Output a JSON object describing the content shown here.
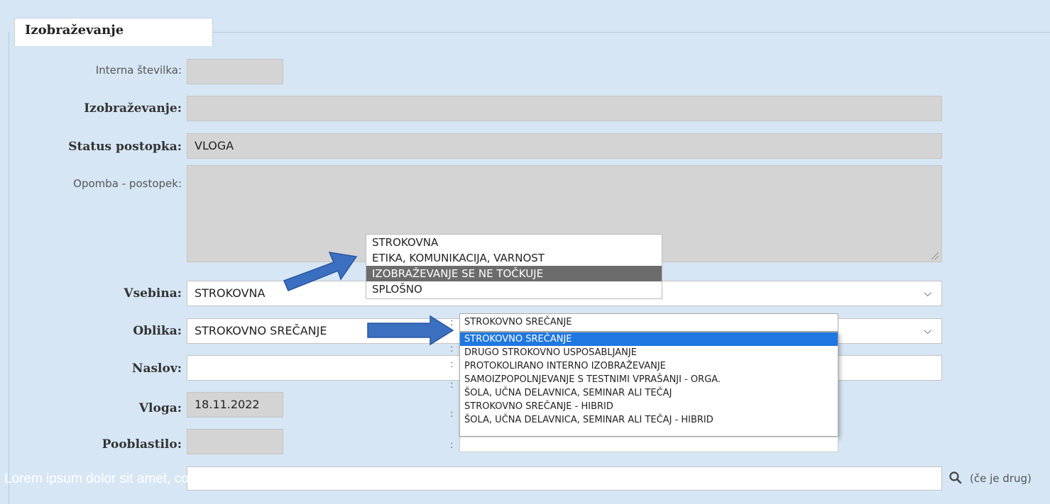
{
  "section": {
    "legend": "Izobraževanje"
  },
  "form": {
    "interna_stevilka": {
      "label": "Interna številka:",
      "value": ""
    },
    "izobrazevanje": {
      "label": "Izobraževanje:",
      "value": ""
    },
    "status": {
      "label": "Status postopka:",
      "value": "VLOGA"
    },
    "opomba": {
      "label": "Opomba - postopek:",
      "value": ""
    },
    "vsebina": {
      "label": "Vsebina:",
      "value": "STROKOVNA"
    },
    "oblika": {
      "label": "Oblika:",
      "value": "STROKOVNO SREČANJE"
    },
    "naslov": {
      "label": "Naslov:",
      "value": ""
    },
    "vloga": {
      "label": "Vloga:",
      "value": "18.11.2022"
    },
    "pooblastilo": {
      "label": "Pooblastilo:",
      "value": ""
    },
    "search_hint": "(če je drug)"
  },
  "vsebina_dropdown": {
    "options": [
      "STROKOVNA",
      "ETIKA, KOMUNIKACIJA, VARNOST",
      "IZOBRAŽEVANJE SE NE TOČKUJE",
      "SPLOŠNO"
    ],
    "selected_index": 2
  },
  "oblika_dropdown": {
    "current": "STROKOVNO SREČANJE",
    "options": [
      "STROKOVNO SREČANJE",
      "DRUGO STROKOVNO USPOSABLJANJE",
      "PROTOKOLIRANO INTERNO IZOBRAŽEVANJE",
      "SAMOIZPOPOLNJEVANJE S TESTNIMI VPRAŠANJI - ORGA.",
      "ŠOLA, UČNA DELAVNICA, SEMINAR ALI TEČAJ",
      "STROKOVNO SREČANJE - HIBRID",
      "ŠOLA, UČNA DELAVNICA, SEMINAR ALI TEČAJ - HIBRID"
    ],
    "selected_index": 0
  },
  "overlay": {
    "text": "Lorem ipsum dolor sit amet, consectetur adipiscing elit"
  },
  "icons": {
    "search": "search-icon",
    "chevron": "chevron-down-icon",
    "arrow": "pointer-arrow-icon"
  },
  "colors": {
    "background": "#d6e6f4",
    "readonly": "#d4d4d4",
    "highlight_gray": "#6c6c6c",
    "highlight_blue": "#1f77e0",
    "arrow": "#3b6fc0"
  }
}
